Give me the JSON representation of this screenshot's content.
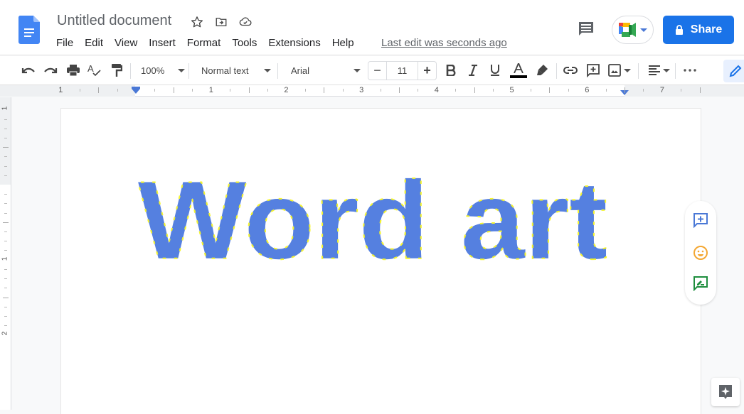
{
  "app": {
    "document_title": "Untitled document",
    "last_edit": "Last edit was seconds ago",
    "share_label": "Share"
  },
  "menu": [
    "File",
    "Edit",
    "View",
    "Insert",
    "Format",
    "Tools",
    "Extensions",
    "Help"
  ],
  "toolbar": {
    "zoom": "100%",
    "style": "Normal text",
    "font": "Arial",
    "font_size": "11",
    "decrease_label": "−",
    "increase_label": "+",
    "text_color": "#000000"
  },
  "ruler": {
    "horizontal_labels": [
      "1",
      "1",
      "2",
      "3",
      "4",
      "5",
      "6",
      "7"
    ],
    "vertical_labels": [
      "1",
      "1",
      "2"
    ]
  },
  "document": {
    "wordart_text": "Word art",
    "wordart_fill": "#5580e0",
    "wordart_point_color": "#f4f430"
  },
  "colors": {
    "accent": "#1a73e8",
    "docs_blue": "#4285f4"
  }
}
